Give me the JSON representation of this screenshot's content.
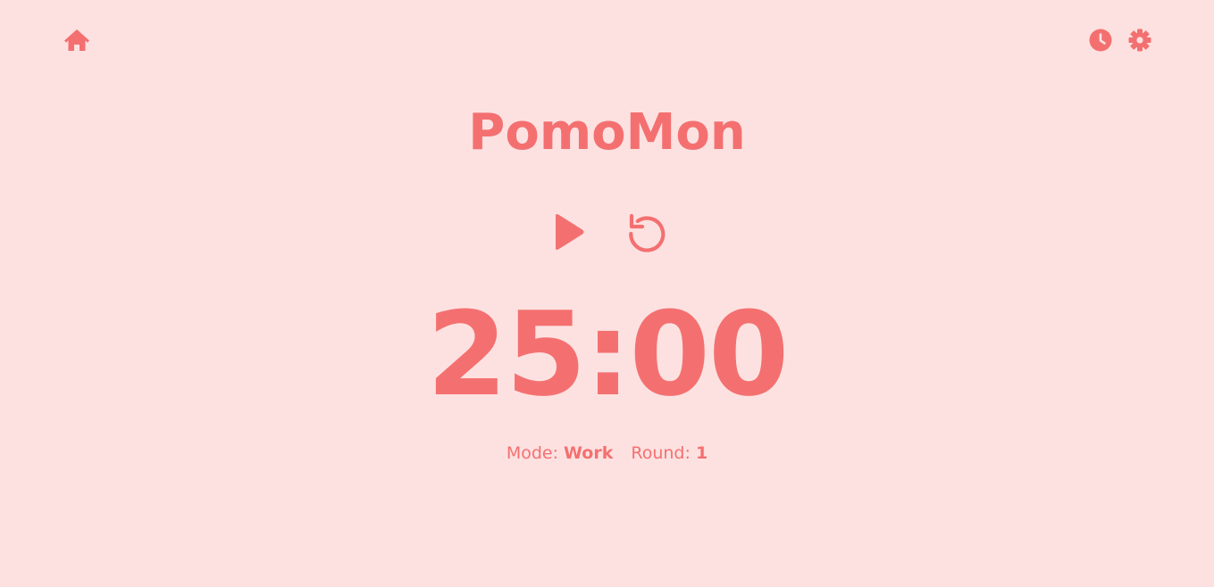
{
  "app": {
    "title": "PomoMon"
  },
  "nav": {
    "home_icon": "home-icon",
    "history_icon": "clock-icon",
    "settings_icon": "gear-icon"
  },
  "controls": {
    "play_icon": "play-icon",
    "reset_icon": "reset-icon"
  },
  "timer": {
    "display": "25:00"
  },
  "status": {
    "mode_label": "Mode:",
    "mode_value": "Work",
    "round_label": "Round:",
    "round_value": "1"
  },
  "colors": {
    "background": "#fde1e1",
    "accent": "#f47070"
  }
}
